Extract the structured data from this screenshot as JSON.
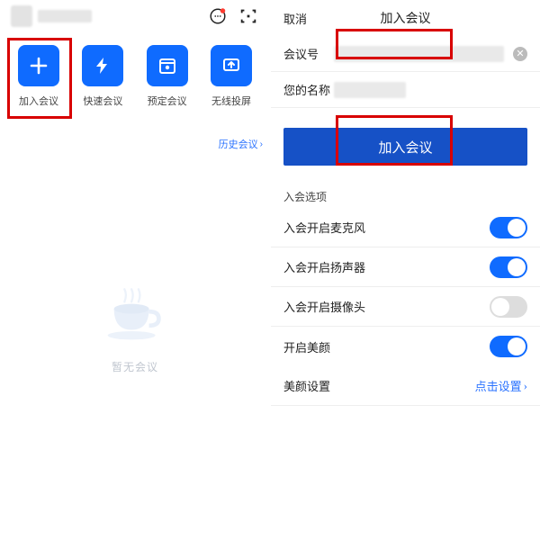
{
  "left": {
    "buttons": {
      "join": {
        "label": "加入会议"
      },
      "quick": {
        "label": "快速会议"
      },
      "schedule": {
        "label": "预定会议"
      },
      "cast": {
        "label": "无线投屏"
      }
    },
    "history_link": "历史会议",
    "empty_text": "暂无会议"
  },
  "right": {
    "cancel": "取消",
    "title": "加入会议",
    "field_number_label": "会议号",
    "field_name_label": "您的名称",
    "join_button": "加入会议",
    "section_title": "入会选项",
    "options": [
      {
        "label": "入会开启麦克风",
        "on": true
      },
      {
        "label": "入会开启扬声器",
        "on": true
      },
      {
        "label": "入会开启摄像头",
        "on": false
      },
      {
        "label": "开启美颜",
        "on": true
      }
    ],
    "beauty_row_label": "美颜设置",
    "beauty_row_link": "点击设置"
  }
}
